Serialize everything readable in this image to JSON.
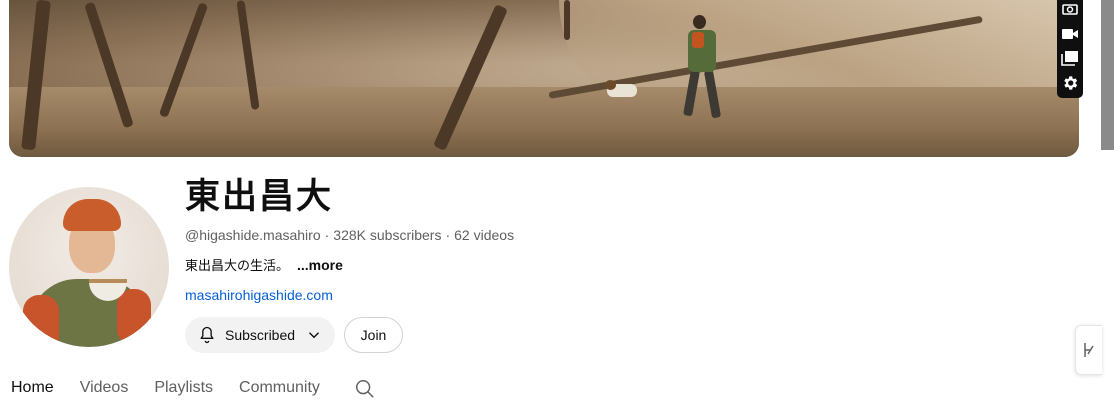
{
  "channel": {
    "name": "東出昌大",
    "handle": "@higashide.masahiro",
    "subscribers": "328K subscribers",
    "videos": "62 videos",
    "description": "東出昌大の生活。",
    "more_label": "...more",
    "link": "masahirohigashide.com"
  },
  "buttons": {
    "subscribed_label": "Subscribed",
    "join_label": "Join"
  },
  "tabs": [
    {
      "label": "Home",
      "active": true
    },
    {
      "label": "Videos",
      "active": false
    },
    {
      "label": "Playlists",
      "active": false
    },
    {
      "label": "Community",
      "active": false
    }
  ],
  "icons": {
    "banner_tools": [
      "camera-icon",
      "video-camera-icon",
      "overlay-icon",
      "gear-icon"
    ],
    "bell": "bell-icon",
    "chevron": "chevron-down-icon",
    "search": "search-icon",
    "side_widget": "side-widget-icon"
  },
  "colors": {
    "link": "#065fd4",
    "secondary_text": "#606060",
    "subscribed_bg": "#f2f2f2"
  }
}
